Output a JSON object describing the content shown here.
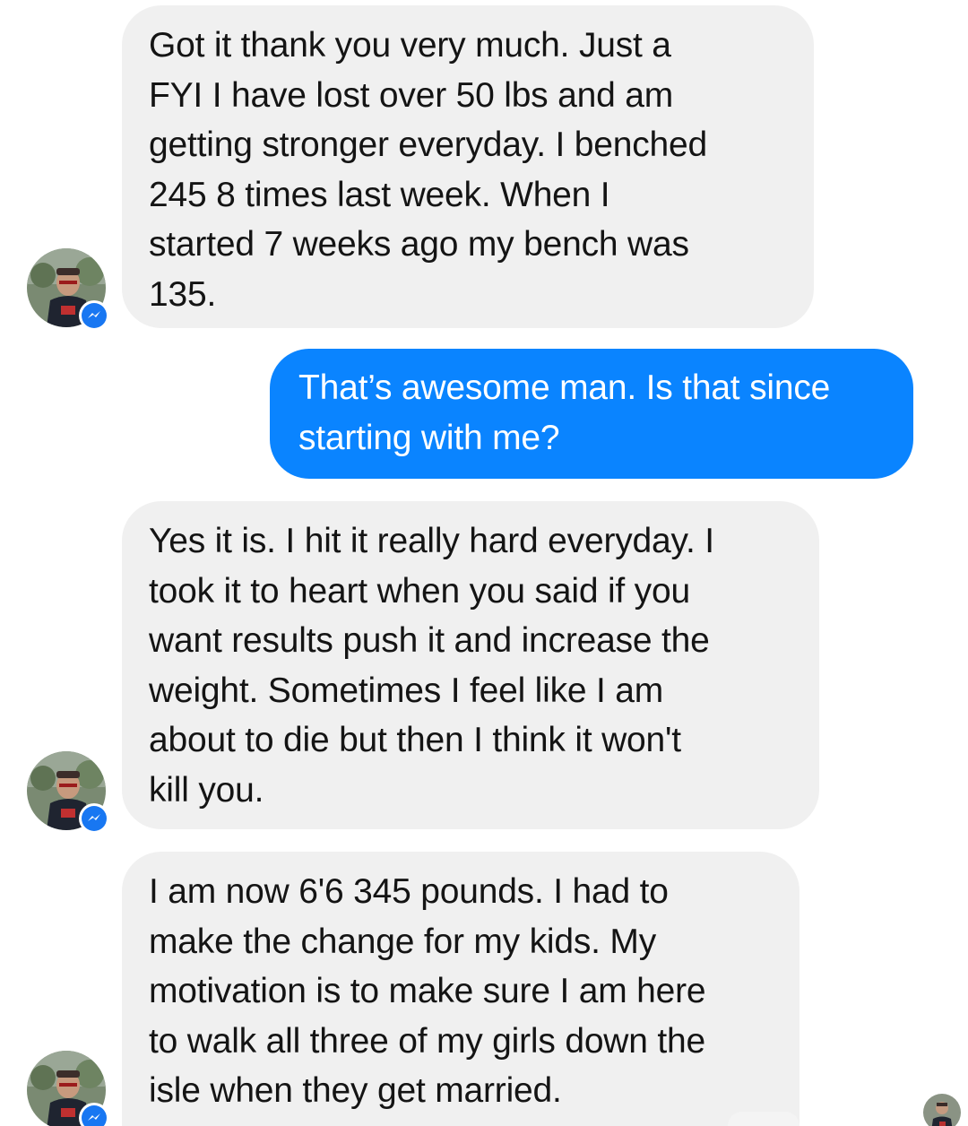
{
  "conversation": {
    "messages": [
      {
        "sender": "contact",
        "text": "Got it thank you very much.  Just a\nFYI I have lost over 50 lbs and am\ngetting stronger everyday.  I benched\n245 8 times last week.  When I\nstarted 7 weeks ago my bench was\n135."
      },
      {
        "sender": "me",
        "text": "That’s awesome man. Is that since\nstarting with me?"
      },
      {
        "sender": "contact",
        "text": "Yes it is.  I hit it really hard everyday.  I\ntook it to heart when you said if you\nwant results push it and increase the\nweight.  Sometimes I feel like I am\nabout to die but then I think it won't\nkill you."
      },
      {
        "sender": "contact",
        "text": "I am now 6'6 345 pounds.  I had to\nmake the change for my kids.  My\nmotivation is to make sure I am here\nto walk all three of my girls down the\nisle when they get married."
      }
    ]
  },
  "icons": {
    "contact_avatar": "contact-avatar",
    "messenger_badge": "messenger-badge-icon",
    "read_receipt": "read-receipt-avatar"
  },
  "colors": {
    "incoming_bubble": "#f0f0f0",
    "outgoing_bubble": "#0a84ff",
    "messenger_blue": "#1877f2"
  }
}
